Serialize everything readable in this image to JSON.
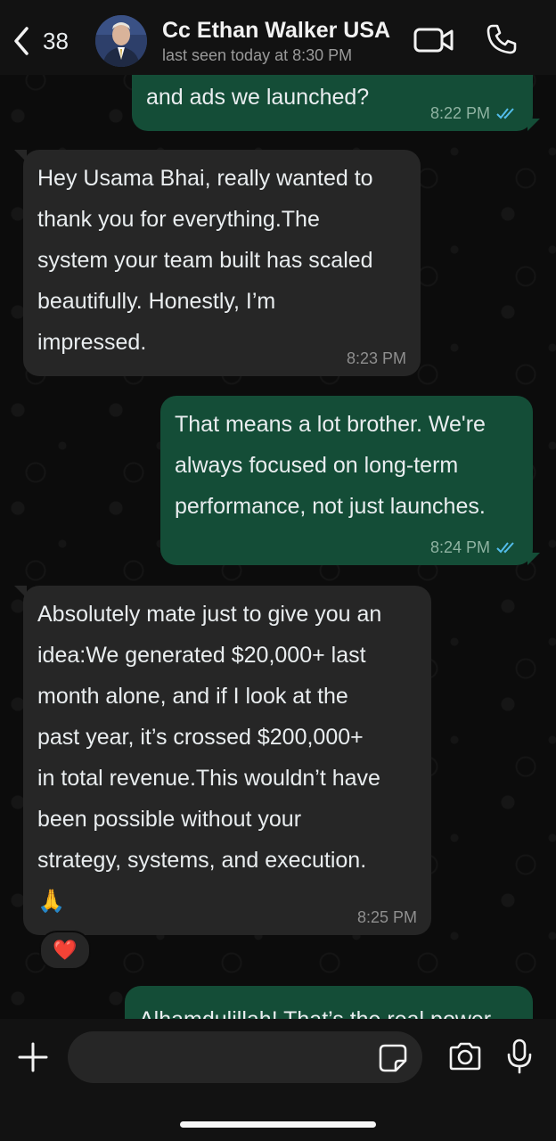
{
  "header": {
    "back_count": "38",
    "contact_name": "Cc Ethan Walker USA",
    "status": "last seen today at 8:30 PM"
  },
  "messages": [
    {
      "direction": "outgoing",
      "text": "and ads we launched?",
      "time": "8:22 PM",
      "read": true
    },
    {
      "direction": "incoming",
      "text": "Hey Usama Bhai, really wanted to\nthank you for everything.The\nsystem your team built has scaled\nbeautifully. Honestly, I’m\nimpressed.",
      "time": "8:23 PM"
    },
    {
      "direction": "outgoing",
      "text": "That means a lot brother. We're\nalways focused on long-term\nperformance, not just launches.",
      "time": "8:24 PM",
      "read": true
    },
    {
      "direction": "incoming",
      "text": "Absolutely mate  just to give you an\nidea:We generated $20,000+ last\nmonth alone, and if I look at the\npast year, it’s crossed $200,000+\nin total revenue.This wouldn’t have\nbeen possible without your\nstrategy, systems, and execution.\n🙏",
      "time": "8:25 PM",
      "reaction": "❤️"
    },
    {
      "direction": "outgoing",
      "text": "Alhamdulillah! That’s the real power"
    }
  ],
  "composer": {
    "placeholder": ""
  },
  "colors": {
    "outgoing_bubble": "#144d37",
    "incoming_bubble": "#262626",
    "read_ticks": "#53bdeb"
  },
  "icons": [
    "chevron-left-icon",
    "video-call-icon",
    "phone-icon",
    "plus-icon",
    "sticker-icon",
    "camera-icon",
    "microphone-icon",
    "double-check-icon"
  ]
}
